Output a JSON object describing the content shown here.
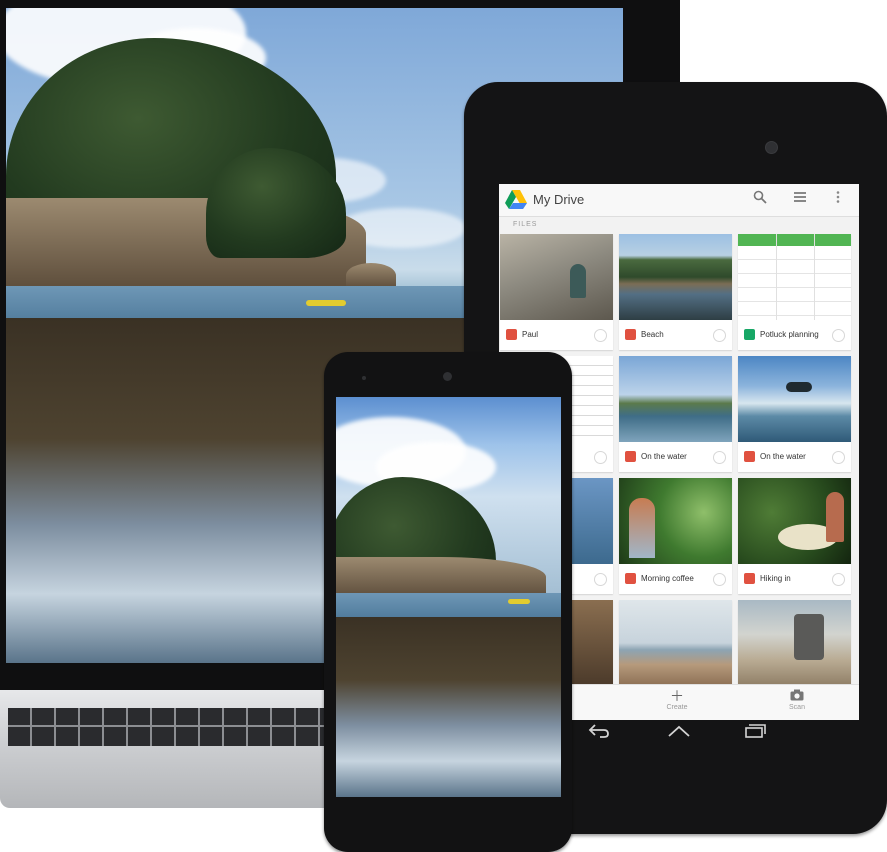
{
  "tablet": {
    "app_title": "My Drive",
    "section_label": "FILES",
    "toolbar_icons": [
      "search-icon",
      "list-view-icon",
      "more-vert-icon"
    ],
    "files": [
      {
        "name": "Paul",
        "type": "photo"
      },
      {
        "name": "Beach",
        "type": "photo"
      },
      {
        "name": "Potluck planning",
        "type": "sheet"
      },
      {
        "name": "",
        "type": "doc"
      },
      {
        "name": "On the water",
        "type": "photo"
      },
      {
        "name": "On the water",
        "type": "photo"
      },
      {
        "name": "",
        "type": "photo"
      },
      {
        "name": "Morning coffee",
        "type": "photo"
      },
      {
        "name": "Hiking in",
        "type": "photo"
      },
      {
        "name": "",
        "type": "photo"
      },
      {
        "name": "",
        "type": "photo"
      },
      {
        "name": "",
        "type": "photo"
      }
    ],
    "bottom_bar": {
      "create_label": "Create",
      "scan_label": "Scan"
    },
    "nav_icons": [
      "back-icon",
      "home-icon",
      "recents-icon"
    ]
  },
  "colors": {
    "photo_file_icon": "#e05140",
    "sheet_file_icon": "#17a766",
    "sheet_header": "#51b553"
  }
}
